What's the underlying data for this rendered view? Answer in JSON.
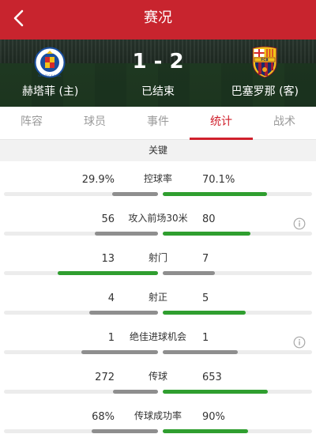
{
  "header": {
    "title": "赛况"
  },
  "match": {
    "home_team": "赫塔菲 (主)",
    "away_team": "巴塞罗那 (客)",
    "score": "1 - 2",
    "status": "已结束",
    "home_crest_text": "GETAFE C.F. S.A.D.",
    "away_crest_text": "FCB"
  },
  "tabs": [
    {
      "label": "阵容"
    },
    {
      "label": "球员"
    },
    {
      "label": "事件"
    },
    {
      "label": "统计",
      "active": true
    },
    {
      "label": "战术"
    }
  ],
  "section": {
    "title": "关键"
  },
  "colors": {
    "brand_red": "#c8242e",
    "leader_green": "#2f9e2f",
    "trailer_gray": "#8e8e8e"
  },
  "stats": [
    {
      "label": "控球率",
      "home": "29.9%",
      "away": "70.1%",
      "home_share": 0.299,
      "away_share": 0.701,
      "leader": "away",
      "info": false
    },
    {
      "label": "攻入前场30米",
      "home": "56",
      "away": "80",
      "home_share": 0.412,
      "away_share": 0.588,
      "leader": "away",
      "info": true
    },
    {
      "label": "射门",
      "home": "13",
      "away": "7",
      "home_share": 0.65,
      "away_share": 0.35,
      "leader": "home",
      "info": false
    },
    {
      "label": "射正",
      "home": "4",
      "away": "5",
      "home_share": 0.444,
      "away_share": 0.556,
      "leader": "away",
      "info": false
    },
    {
      "label": "绝佳进球机会",
      "home": "1",
      "away": "1",
      "home_share": 0.5,
      "away_share": 0.5,
      "leader": "none",
      "info": true
    },
    {
      "label": "传球",
      "home": "272",
      "away": "653",
      "home_share": 0.294,
      "away_share": 0.706,
      "leader": "away",
      "info": false
    },
    {
      "label": "传球成功率",
      "home": "68%",
      "away": "90%",
      "home_share": 0.43,
      "away_share": 0.57,
      "leader": "away",
      "info": false
    }
  ]
}
